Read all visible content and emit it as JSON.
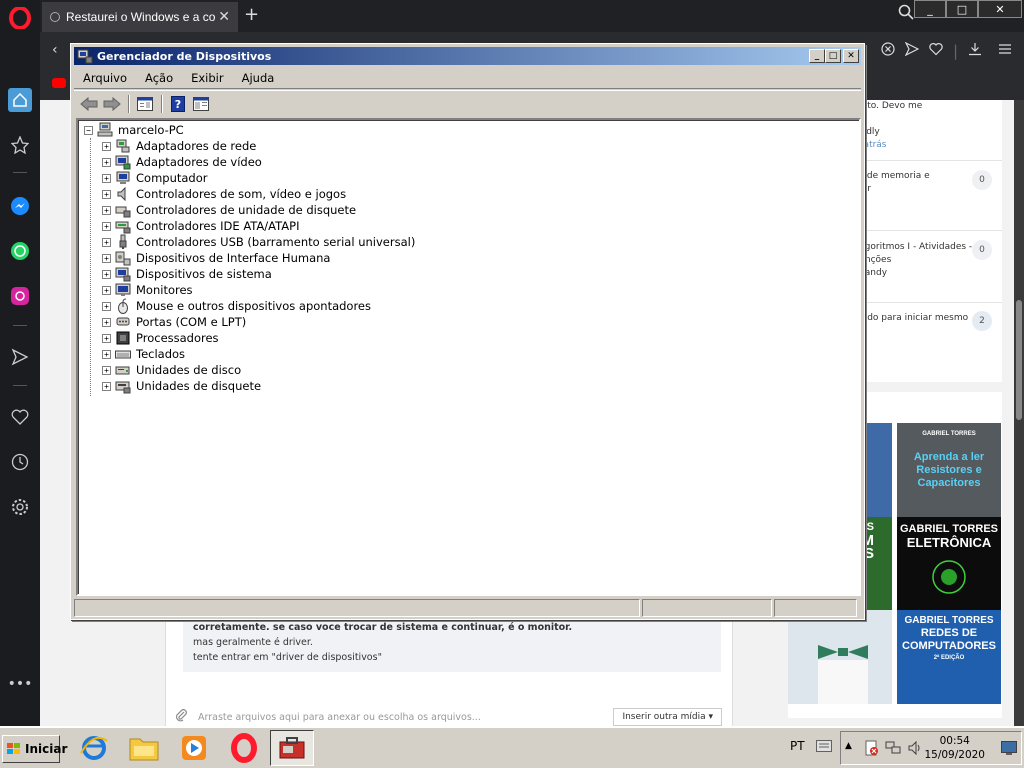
{
  "browser": {
    "tab_title": "Restaurei o Windows e a cor",
    "tab_close": "✕",
    "new_tab": "+",
    "min_label": "_",
    "max_label": "□",
    "close_label": "✕"
  },
  "page": {
    "right_panel": [
      {
        "text": "ento. Devo me",
        "text2": "?",
        "author": "osdly",
        "meta": "s atrás",
        "badge": ""
      },
      {
        "text": "ia de memoria e",
        "text2": "dor",
        "author": "",
        "meta": "ás",
        "badge": "0"
      },
      {
        "text": "Algoritmos I - Atividades -",
        "text2": "funções",
        "author": "mandy",
        "meta": "ás",
        "badge": "0"
      },
      {
        "text": "ando para iniciar mesmo",
        "text2": "",
        "author": "19",
        "meta": "ás",
        "badge": "2"
      }
    ],
    "books": [
      {
        "author": "GABRIEL TORRES",
        "title": "Aprenda a ler Resistores e Capacitores"
      },
      {
        "author": "GABRIEL TORRES",
        "title": "ELETRÔNICA"
      },
      {
        "author": "GABRIEL TORRES",
        "title": "REDES DE COMPUTADORES",
        "edition": "2ª EDIÇÃO"
      }
    ],
    "books_left_fragments": [
      "ES",
      "M",
      "S"
    ],
    "post_lines": [
      "corretamente. se caso voce trocar de sistema e continuar, é o  monitor.",
      "mas geralmente é driver.",
      "tente entrar em \"driver de dispositivos\""
    ],
    "attach_placeholder": "Arraste arquivos aqui para anexar ou escolha os arquivos...",
    "insert_media": "Inserir outra mídia ▾"
  },
  "devmgr": {
    "title": "Gerenciador de Dispositivos",
    "cap_min": "_",
    "cap_max": "□",
    "cap_close": "✕",
    "menu": [
      "Arquivo",
      "Ação",
      "Exibir",
      "Ajuda"
    ],
    "toolbar": [
      "back-icon",
      "forward-icon",
      "properties-icon",
      "help-icon",
      "view-icon"
    ],
    "root": "marcelo-PC",
    "devices": [
      {
        "label": "Adaptadores de rede",
        "icon": "network-adapter-icon"
      },
      {
        "label": "Adaptadores de vídeo",
        "icon": "display-adapter-icon"
      },
      {
        "label": "Computador",
        "icon": "computer-icon"
      },
      {
        "label": "Controladores de som, vídeo e jogos",
        "icon": "sound-icon"
      },
      {
        "label": "Controladores de unidade de disquete",
        "icon": "floppy-controller-icon"
      },
      {
        "label": "Controladores IDE ATA/ATAPI",
        "icon": "ide-controller-icon"
      },
      {
        "label": "Controladores USB (barramento serial universal)",
        "icon": "usb-icon"
      },
      {
        "label": "Dispositivos de Interface Humana",
        "icon": "hid-icon"
      },
      {
        "label": "Dispositivos de sistema",
        "icon": "system-device-icon"
      },
      {
        "label": "Monitores",
        "icon": "monitor-icon"
      },
      {
        "label": "Mouse e outros dispositivos apontadores",
        "icon": "mouse-icon"
      },
      {
        "label": "Portas (COM e LPT)",
        "icon": "port-icon"
      },
      {
        "label": "Processadores",
        "icon": "processor-icon"
      },
      {
        "label": "Teclados",
        "icon": "keyboard-icon"
      },
      {
        "label": "Unidades de disco",
        "icon": "disk-drive-icon"
      },
      {
        "label": "Unidades de disquete",
        "icon": "floppy-drive-icon"
      }
    ],
    "expander_symbol": "+",
    "root_expander_symbol": "−"
  },
  "taskbar": {
    "start_label": "Iniciar",
    "language": "PT",
    "time": "00:54",
    "date": "15/09/2020"
  },
  "colors": {
    "titlebar_start": "#0a246a",
    "titlebar_end": "#a6caf0",
    "opera_red": "#ff1b2d"
  }
}
